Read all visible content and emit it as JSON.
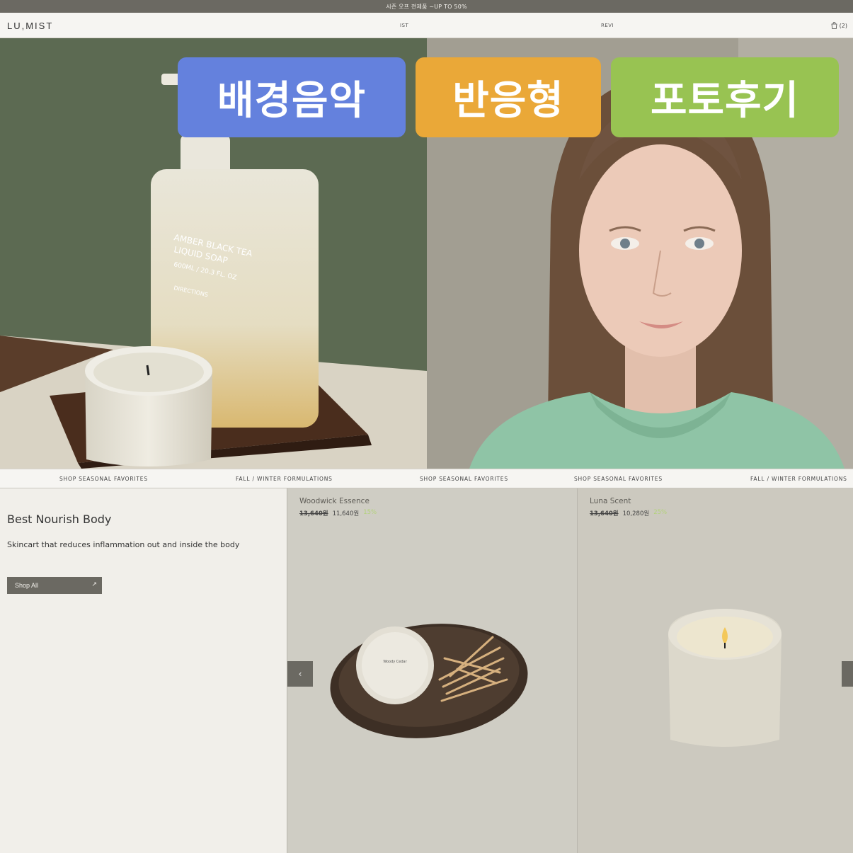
{
  "announcement": {
    "text": "시즌 오프 전제품 ~UP TO 50%"
  },
  "header": {
    "logo": "LU,MIST",
    "nav_fragment_1": "IST",
    "nav_fragment_2": "REVI",
    "cart_count": "(2)"
  },
  "badges": [
    {
      "label": "배경음악",
      "color": "#6481dd"
    },
    {
      "label": "반응형",
      "color": "#eaa838"
    },
    {
      "label": "포토후기",
      "color": "#98c352"
    }
  ],
  "marquee": [
    "SHOP SEASONAL FAVORITES",
    "FALL / WINTER FORMULATIONS",
    "SHOP SEASONAL FAVORITES",
    "SHOP SEASONAL FAVORITES",
    "FALL / WINTER FORMULATIONS"
  ],
  "hero": {
    "left_photo": {
      "soap_label_1": "AMBER BLACK TEA",
      "soap_label_2": "LIQUID SOAP",
      "soap_volume": "600ML / 20.3 FL. OZ",
      "soap_directions": "DIRECTIONS"
    },
    "right_photo": {}
  },
  "intro": {
    "title": "Best Nourish Body",
    "subtitle": "Skincart that reduces inflammation out and inside the body",
    "button_label": "Shop All"
  },
  "products": [
    {
      "name": "Woodwick Essence",
      "old_price": "13,640원",
      "price": "11,640원",
      "discount": "15%",
      "item_label": "Woody Cedar"
    },
    {
      "name": "Luna Scent",
      "old_price": "13,640원",
      "price": "10,280원",
      "discount": "25%"
    }
  ],
  "colors": {
    "header_bar": "#6b6962",
    "accent_green": "#b3d27a"
  }
}
